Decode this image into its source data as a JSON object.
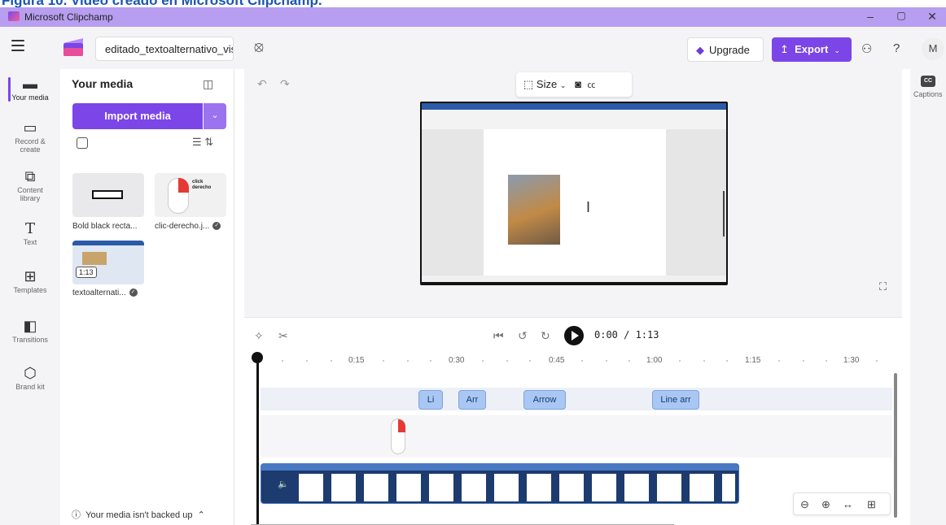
{
  "caption": "Figura 10. Video creado en Microsoft Clipchamp.",
  "window": {
    "title": "Microsoft Clipchamp",
    "minimize": "–",
    "maximize": "▢",
    "close": "✕"
  },
  "topbar": {
    "project_name": "editado_textoalternativo_visi",
    "upgrade_label": "Upgrade",
    "export_label": "Export",
    "avatar_initial": "M",
    "help": "?"
  },
  "nav": {
    "items": [
      {
        "label": "Your media",
        "icon": "folder-icon"
      },
      {
        "label": "Record & create",
        "icon": "camera-icon"
      },
      {
        "label": "Content library",
        "icon": "library-icon"
      },
      {
        "label": "Text",
        "icon": "text-icon"
      },
      {
        "label": "Templates",
        "icon": "templates-icon"
      },
      {
        "label": "Transitions",
        "icon": "transitions-icon"
      },
      {
        "label": "Brand kit",
        "icon": "brand-kit-icon"
      }
    ]
  },
  "media_panel": {
    "title": "Your media",
    "import_label": "Import media",
    "items": [
      {
        "label": "Bold black recta...",
        "checked": false
      },
      {
        "label": "clic-derecho.j...",
        "checked": true,
        "thumb_text": "click derecho"
      },
      {
        "label": "textoalternati...",
        "checked": true,
        "duration": "1:13"
      }
    ],
    "backup_notice": "Your media isn't backed up"
  },
  "preview": {
    "size_label": "Size"
  },
  "right_panel": {
    "captions_label": "Captions",
    "cc": "CC"
  },
  "timeline": {
    "timecode": "0:00 / 1:13",
    "ticks": [
      "0:15",
      "0:30",
      "0:45",
      "1:00",
      "1:15",
      "1:30"
    ],
    "text_chips": [
      "Li",
      "Arr",
      "Arrow",
      "Line arr"
    ]
  },
  "colors": {
    "accent": "#7b45e8",
    "titlebar": "#b79ef0",
    "chip": "#a9c7f2",
    "video_track": "#1d3b6e"
  }
}
